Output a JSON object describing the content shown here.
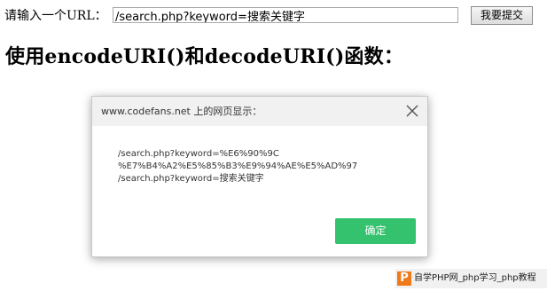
{
  "form": {
    "label": "请输入一个URL：",
    "url_value": "/search.php?keyword=搜索关键字",
    "submit_label": "我要提交"
  },
  "heading": "使用encodeURI()和decodeURI()函数：",
  "dialog": {
    "title": "www.codefans.net 上的网页显示：",
    "lines": [
      "/search.php?keyword=%E6%90%9C",
      "%E7%B4%A2%E5%85%B3%E9%94%AE%E5%AD%97",
      "/search.php?keyword=搜索关键字"
    ],
    "ok_label": "确定"
  },
  "watermark": {
    "logo_letter": "P",
    "text": "自学PHP网_php学习_php教程"
  },
  "colors": {
    "ok_button": "#34c26e",
    "watermark_logo": "#f07a1a",
    "dialog_header": "#f1f1f1"
  },
  "icons": {
    "close": "close-icon"
  }
}
